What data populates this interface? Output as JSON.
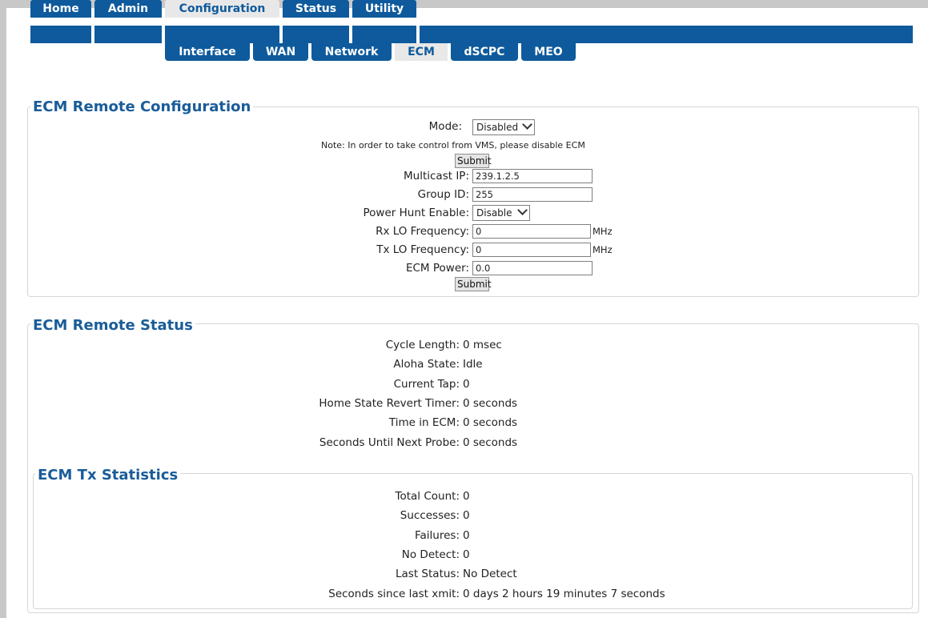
{
  "top_tabs": [
    {
      "label": "Home",
      "active": false
    },
    {
      "label": "Admin",
      "active": false
    },
    {
      "label": "Configuration",
      "active": true
    },
    {
      "label": "Status",
      "active": false
    },
    {
      "label": "Utility",
      "active": false
    }
  ],
  "sub_tabs": [
    {
      "label": "Interface",
      "active": false
    },
    {
      "label": "WAN",
      "active": false
    },
    {
      "label": "Network",
      "active": false
    },
    {
      "label": "ECM",
      "active": true
    },
    {
      "label": "dSCPC",
      "active": false
    },
    {
      "label": "MEO",
      "active": false
    }
  ],
  "config": {
    "title": "ECM Remote Configuration",
    "mode_label": "Mode:",
    "mode_value": "Disabled",
    "note": "Note: In order to take control from VMS, please disable ECM",
    "submit1": "Submit",
    "multicast_ip_label": "Multicast IP:",
    "multicast_ip_value": "239.1.2.5",
    "group_id_label": "Group ID:",
    "group_id_value": "255",
    "power_hunt_label": "Power Hunt Enable:",
    "power_hunt_value": "Disable",
    "rx_lo_label": "Rx LO Frequency:",
    "rx_lo_value": "0",
    "rx_lo_unit": "MHz",
    "tx_lo_label": "Tx LO Frequency:",
    "tx_lo_value": "0",
    "tx_lo_unit": "MHz",
    "ecm_power_label": "ECM Power:",
    "ecm_power_value": "0.0",
    "submit2": "Submit"
  },
  "status": {
    "title": "ECM Remote Status",
    "rows": [
      {
        "label": "Cycle Length:",
        "value": "0 msec"
      },
      {
        "label": "Aloha State:",
        "value": "Idle"
      },
      {
        "label": "Current Tap:",
        "value": "0"
      },
      {
        "label": "Home State Revert Timer:",
        "value": "0 seconds"
      },
      {
        "label": "Time in ECM:",
        "value": "0 seconds"
      },
      {
        "label": "Seconds Until Next Probe:",
        "value": "0 seconds"
      }
    ]
  },
  "tx_stats": {
    "title": "ECM Tx Statistics",
    "rows": [
      {
        "label": "Total Count:",
        "value": "0"
      },
      {
        "label": "Successes:",
        "value": "0"
      },
      {
        "label": "Failures:",
        "value": "0"
      },
      {
        "label": "No Detect:",
        "value": "0"
      },
      {
        "label": "Last Status:",
        "value": "No Detect"
      },
      {
        "label": "Seconds since last xmit:",
        "value": "0 days 2 hours 19 minutes 7 seconds"
      }
    ]
  }
}
